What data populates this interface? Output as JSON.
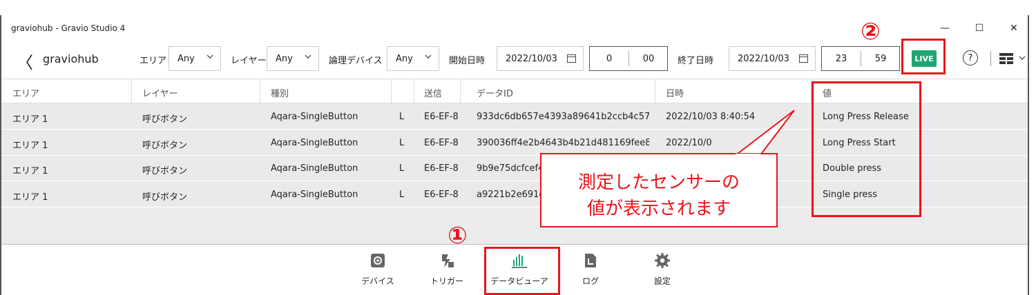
{
  "window": {
    "title": "graviohub - Gravio Studio 4",
    "min": "—",
    "max": "☐",
    "close": "✕"
  },
  "toolbar": {
    "back": "〈",
    "hub_name": "graviohub",
    "area_label": "エリア",
    "area_value": "Any",
    "layer_label": "レイヤー",
    "layer_value": "Any",
    "device_label": "論理デバイス",
    "device_value": "Any",
    "start_label": "開始日時",
    "start_date": "2022/10/03",
    "start_hour": "0",
    "start_min": "00",
    "end_label": "終了日時",
    "end_date": "2022/10/03",
    "end_hour": "23",
    "end_min": "59",
    "live": "LIVE",
    "help": "?"
  },
  "table": {
    "headers": [
      "エリア",
      "レイヤー",
      "種別",
      "",
      "送信",
      "データID",
      "日時",
      "値"
    ],
    "rows": [
      [
        "エリア 1",
        "呼びボタン",
        "Aqara-SingleButton",
        "L",
        "E6-EF-8",
        "933dc6db657e4393a89641b2ccb4c57",
        "2022/10/03 8:40:54",
        "Long Press Release"
      ],
      [
        "エリア 1",
        "呼びボタン",
        "Aqara-SingleButton",
        "L",
        "E6-EF-8",
        "390036ff4e2b4643b4b21d481169fee8",
        "2022/10/0",
        "Long Press Start"
      ],
      [
        "エリア 1",
        "呼びボタン",
        "Aqara-SingleButton",
        "L",
        "E6-EF-8",
        "9b9e75dcfcef4",
        "",
        "Double press"
      ],
      [
        "エリア 1",
        "呼びボタン",
        "Aqara-SingleButton",
        "L",
        "E6-EF-8",
        "a9221b2e691c",
        "",
        "Single press"
      ]
    ]
  },
  "bottom_nav": [
    {
      "label": "デバイス",
      "icon": "device-icon"
    },
    {
      "label": "トリガー",
      "icon": "trigger-icon"
    },
    {
      "label": "データビューア",
      "icon": "data-viewer-icon"
    },
    {
      "label": "ログ",
      "icon": "log-icon"
    },
    {
      "label": "設定",
      "icon": "settings-icon"
    }
  ],
  "annotations": {
    "marker1": "①",
    "marker2": "②",
    "callout_line1": "測定したセンサーの",
    "callout_line2": "値が表示されます",
    "color": "#e8141c"
  },
  "colors": {
    "live_green": "#1ea772",
    "row_bg": "#eaeaea"
  }
}
